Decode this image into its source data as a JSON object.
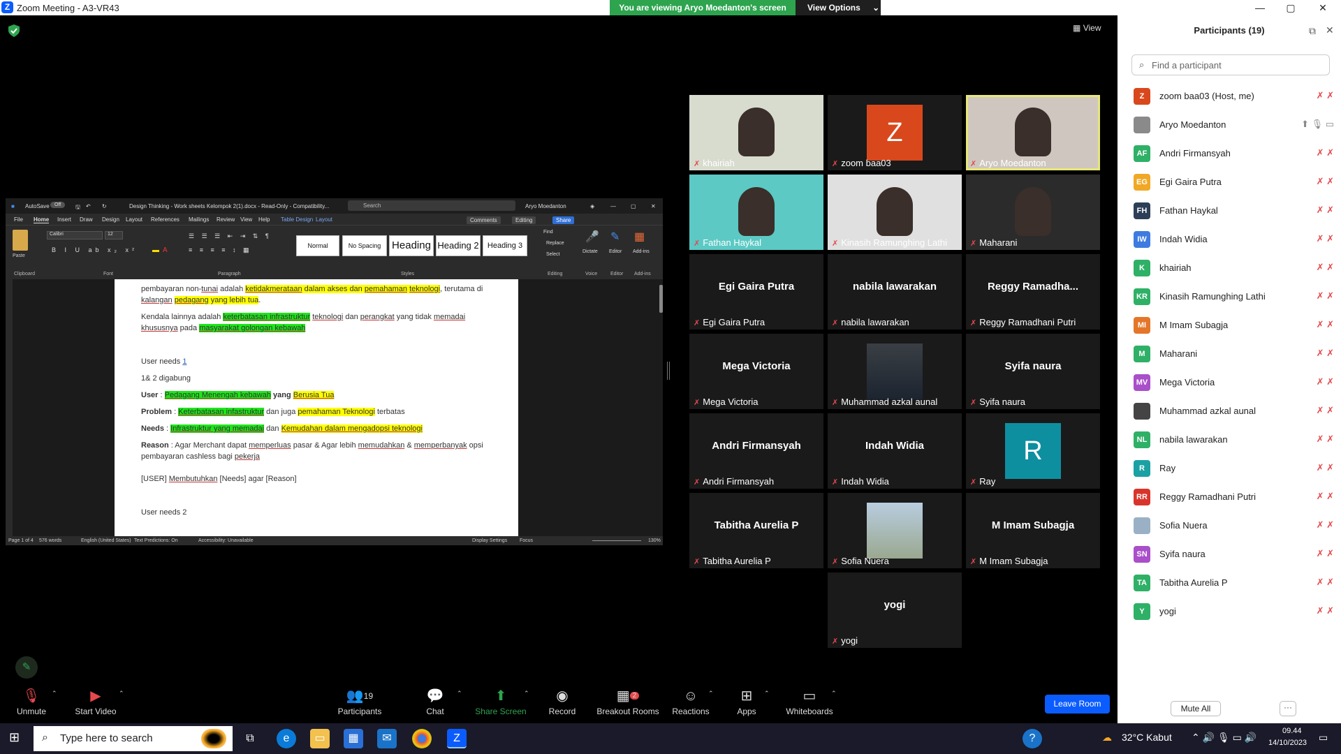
{
  "window": {
    "title": "Zoom Meeting - A3-VR43",
    "minimize": "—",
    "maximize": "▢",
    "close": "✕"
  },
  "banner": {
    "viewing": "You are viewing Aryo Moedanton's screen",
    "view_options": "View Options"
  },
  "view_label": "View",
  "word": {
    "autosave": "AutoSave",
    "toggle": "Off",
    "doc_title": "Design Thinking - Work sheets Kelompok 2(1).docx - Read-Only - Compatibility...",
    "search": "Search",
    "user": "Aryo Moedanton",
    "menu": [
      "File",
      "Home",
      "Insert",
      "Draw",
      "Design",
      "Layout",
      "References",
      "Mailings",
      "Review",
      "View",
      "Help",
      "Table Design",
      "Layout"
    ],
    "comments": "Comments",
    "editing": "Editing",
    "share": "Share",
    "font": "Calibri",
    "font_size": "12",
    "paste": "Paste",
    "styles": [
      "Normal",
      "No Spacing",
      "Heading",
      "Heading 2",
      "Heading 3"
    ],
    "find": "Find",
    "replace": "Replace",
    "select": "Select",
    "dictate": "Dictate",
    "editor": "Editor",
    "addins": "Add-ins",
    "groups": [
      "Clipboard",
      "Font",
      "Paragraph",
      "Styles",
      "Editing",
      "Voice",
      "Editor",
      "Add-ins"
    ],
    "lines": {
      "l1a": "pembayaran non-",
      "l1b": "tunai",
      "l1c": " adalah ",
      "l1d": "ketidakmerataan",
      "l1e": " dalam akses dan ",
      "l1f": "pemahaman",
      "l1g": " ",
      "l1h": "teknologi",
      "l1i": ", terutama di",
      "l2a": "kalangan",
      "l2b": " ",
      "l2c": "pedagang",
      "l2d": " yang lebih tua",
      "l2e": ".",
      "l3a": "Kendala lainnya adalah ",
      "l3b": "keterbatasan infrastruktur",
      "l3c": " ",
      "l3d": "teknologi",
      "l3e": " dan ",
      "l3f": "perangkat",
      "l3g": " yang tidak ",
      "l3h": "memadai",
      "l4a": "khususnya",
      "l4b": " pada ",
      "l4c": "masyarakat golongan kebawah",
      "un1a": "User needs ",
      "un1b": "1",
      "l5": "1& 2 digabung",
      "l6a": "User",
      "l6b": " : ",
      "l6c": "Pedagang Menengah kebawah",
      "l6d": " yang ",
      "l6e": "Berusia Tua",
      "l7a": "Problem",
      "l7b": " : ",
      "l7c": "Keterbatasan infastruktur",
      "l7d": " dan juga ",
      "l7e": "pemahaman Teknologi",
      "l7f": " terbatas",
      "l8a": "Needs",
      "l8b": " : ",
      "l8c": "Infrastruktur yang memadai",
      "l8d": " dan ",
      "l8e": "Kemudahan dalam mengadopsi teknologi",
      "l9a": "Reason",
      "l9b": " : Agar Merchant dapat ",
      "l9c": "memperluas",
      "l9d": " pasar & Agar lebih ",
      "l9e": "memudahkan",
      "l9f": " & ",
      "l9g": "memperbanyak",
      "l9h": " opsi",
      "l10a": "pembayaran cashless bagi ",
      "l10b": "pekerja",
      "l11a": "[USER] ",
      "l11b": "Membutuhkan",
      "l11c": " [Needs] agar [Reason]",
      "l12": "User needs 2"
    },
    "status": {
      "page": "Page 1 of 4",
      "words": "576 words",
      "lang": "English (United States)",
      "predict": "Text Predictions: On",
      "access": "Accessibility: Unavailable",
      "display": "Display Settings",
      "focus": "Focus",
      "zoom": "130%"
    }
  },
  "tiles": [
    {
      "name": "khairiah",
      "kind": "video"
    },
    {
      "name": "zoom baa03",
      "kind": "avatar",
      "letter": "Z",
      "color": "#d9481c"
    },
    {
      "name": "Aryo Moedanton",
      "kind": "video"
    },
    {
      "name": "Fathan Haykal",
      "kind": "video"
    },
    {
      "name": "Kinasih Ramunghing Lathi",
      "kind": "video"
    },
    {
      "name": "Maharani",
      "kind": "video"
    },
    {
      "name": "Egi Gaira Putra",
      "big": "Egi Gaira Putra",
      "kind": "text"
    },
    {
      "name": "nabila lawarakan",
      "big": "nabila lawarakan",
      "kind": "text"
    },
    {
      "name": "Reggy Ramadhani Putri",
      "big": "Reggy  Ramadha...",
      "kind": "text"
    },
    {
      "name": "Mega Victoria",
      "big": "Mega Victoria",
      "kind": "text"
    },
    {
      "name": "Muhammad azkal aunal",
      "kind": "photo"
    },
    {
      "name": "Syifa naura",
      "big": "Syifa naura",
      "kind": "text"
    },
    {
      "name": "Andri Firmansyah",
      "big": "Andri Firmansyah",
      "kind": "text"
    },
    {
      "name": "Indah Widia",
      "big": "Indah Widia",
      "kind": "text"
    },
    {
      "name": "Ray",
      "kind": "avatar",
      "letter": "R",
      "color": "#0e8fa0"
    },
    {
      "name": "Tabitha Aurelia P",
      "big": "Tabitha Aurelia P",
      "kind": "text"
    },
    {
      "name": "Sofia Nuera",
      "kind": "photo"
    },
    {
      "name": "M Imam Subagja",
      "big": "M Imam Subagja",
      "kind": "text"
    },
    {
      "name": "yogi",
      "big": "yogi",
      "kind": "text"
    }
  ],
  "panel": {
    "title": "Participants (19)",
    "search_placeholder": "Find a participant",
    "mute_all": "Mute All",
    "more": "···",
    "participants": [
      {
        "initials": "Z",
        "name": "zoom baa03 (Host, me)",
        "color": "#d9481c"
      },
      {
        "initials": "",
        "name": "Aryo Moedanton",
        "color": "#8a8a8a"
      },
      {
        "initials": "AF",
        "name": "Andri Firmansyah",
        "color": "#2fb067"
      },
      {
        "initials": "EG",
        "name": "Egi Gaira Putra",
        "color": "#f0a825"
      },
      {
        "initials": "FH",
        "name": "Fathan Haykal",
        "color": "#2d3e57"
      },
      {
        "initials": "IW",
        "name": "Indah Widia",
        "color": "#3d7be0"
      },
      {
        "initials": "K",
        "name": "khairiah",
        "color": "#2fb067"
      },
      {
        "initials": "KR",
        "name": "Kinasih Ramunghing Lathi",
        "color": "#2fb067"
      },
      {
        "initials": "MI",
        "name": "M Imam Subagja",
        "color": "#e4762a"
      },
      {
        "initials": "M",
        "name": "Maharani",
        "color": "#2fb067"
      },
      {
        "initials": "MV",
        "name": "Mega Victoria",
        "color": "#a94fc9"
      },
      {
        "initials": "",
        "name": "Muhammad azkal aunal",
        "color": "#444444"
      },
      {
        "initials": "NL",
        "name": "nabila lawarakan",
        "color": "#2fb067"
      },
      {
        "initials": "R",
        "name": "Ray",
        "color": "#1ba1a4"
      },
      {
        "initials": "RR",
        "name": "Reggy Ramadhani Putri",
        "color": "#d9342b"
      },
      {
        "initials": "",
        "name": "Sofia Nuera",
        "color": "#9ab0c4"
      },
      {
        "initials": "SN",
        "name": "Syifa naura",
        "color": "#a94fc9"
      },
      {
        "initials": "TA",
        "name": "Tabitha Aurelia P",
        "color": "#2fb067"
      },
      {
        "initials": "Y",
        "name": "yogi",
        "color": "#2fb067"
      }
    ]
  },
  "toolbar": {
    "unmute": "Unmute",
    "start_video": "Start Video",
    "participants": "Participants",
    "participants_count": "19",
    "chat": "Chat",
    "share": "Share Screen",
    "record": "Record",
    "breakout": "Breakout Rooms",
    "breakout_badge": "2",
    "reactions": "Reactions",
    "apps": "Apps",
    "whiteboards": "Whiteboards",
    "leave": "Leave Room"
  },
  "taskbar": {
    "search_placeholder": "Type here to search",
    "weather": "32°C  Kabut",
    "time": "09.44",
    "date": "14/10/2023"
  }
}
